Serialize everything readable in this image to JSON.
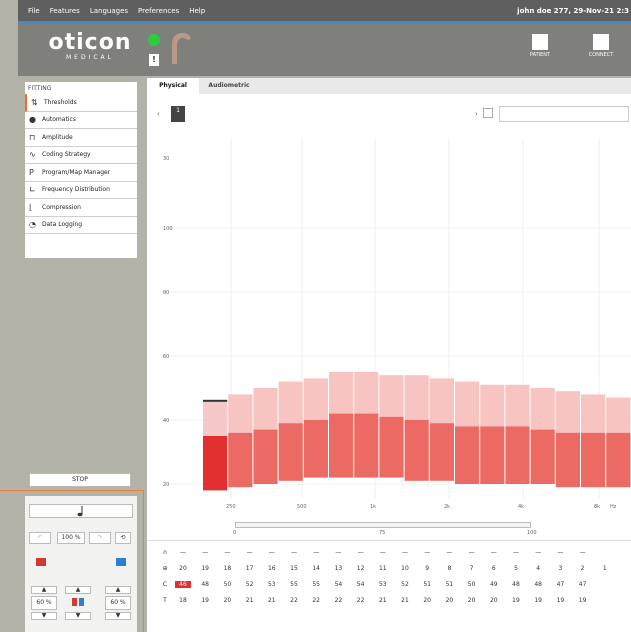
{
  "menu": {
    "items": [
      "File",
      "Features",
      "Languages",
      "Preferences",
      "Help"
    ],
    "user": "john doe 277, 29-Nov-21 2:3"
  },
  "logo": {
    "text": "oticon",
    "sub": "MEDICAL"
  },
  "header": {
    "battery": "!",
    "patient": "PATIENT",
    "connect": "CONNECT"
  },
  "sidebar": {
    "heading": "FITTING",
    "items": [
      {
        "label": "Thresholds",
        "icon": "thresholds-icon",
        "glyph": "⇅",
        "active": true
      },
      {
        "label": "Automatics",
        "icon": "automatics-icon",
        "glyph": "●",
        "active": false
      },
      {
        "label": "Amplitude",
        "icon": "amplitude-icon",
        "glyph": "⊓",
        "active": false
      },
      {
        "label": "Coding Strategy",
        "icon": "coding-strategy-icon",
        "glyph": "∿",
        "active": false
      },
      {
        "label": "Program/Map Manager",
        "icon": "program-map-icon",
        "glyph": "P",
        "active": false
      },
      {
        "label": "Frequency Distribution",
        "icon": "frequency-icon",
        "glyph": "∟",
        "active": false
      },
      {
        "label": "Compression",
        "icon": "compression-icon",
        "glyph": "⌊",
        "active": false
      },
      {
        "label": "Data Logging",
        "icon": "data-logging-icon",
        "glyph": "◔",
        "active": false
      }
    ]
  },
  "controls": {
    "stop": "STOP",
    "zoom": "100 %",
    "left_level": "60 %",
    "right_level": "60 %"
  },
  "tabs": [
    "Physical",
    "Audiometric"
  ],
  "toolbar": {
    "channel": "1"
  },
  "chart_data": {
    "type": "bar",
    "yticks": [
      "20",
      "40",
      "60",
      "80",
      "100",
      "30"
    ],
    "xticks": [
      "250",
      "500",
      "1k",
      "2k",
      "4k",
      "8k",
      "Hz"
    ],
    "bars": [
      {
        "t": 18,
        "c": 46,
        "top": 35
      },
      {
        "t": 19,
        "c": 48,
        "top": 36
      },
      {
        "t": 20,
        "c": 50,
        "top": 37
      },
      {
        "t": 21,
        "c": 52,
        "top": 39
      },
      {
        "t": 22,
        "c": 53,
        "top": 40
      },
      {
        "t": 22,
        "c": 55,
        "top": 42
      },
      {
        "t": 22,
        "c": 55,
        "top": 42
      },
      {
        "t": 22,
        "c": 54,
        "top": 41
      },
      {
        "t": 21,
        "c": 54,
        "top": 40
      },
      {
        "t": 21,
        "c": 53,
        "top": 39
      },
      {
        "t": 20,
        "c": 52,
        "top": 38
      },
      {
        "t": 20,
        "c": 51,
        "top": 38
      },
      {
        "t": 20,
        "c": 51,
        "top": 38
      },
      {
        "t": 20,
        "c": 50,
        "top": 37
      },
      {
        "t": 19,
        "c": 49,
        "top": 36
      },
      {
        "t": 19,
        "c": 48,
        "top": 36
      },
      {
        "t": 19,
        "c": 47,
        "top": 36
      }
    ]
  },
  "slider": {
    "left": "0",
    "mid": "75",
    "right": "100"
  },
  "table": {
    "rows": [
      {
        "label": "∩",
        "values": [
          "—",
          "—",
          "—",
          "—",
          "—",
          "—",
          "—",
          "—",
          "—",
          "—",
          "—",
          "—",
          "—",
          "—",
          "—",
          "—",
          "—",
          "—",
          "—"
        ]
      },
      {
        "label": "⊕",
        "values": [
          "20",
          "19",
          "18",
          "17",
          "16",
          "15",
          "14",
          "13",
          "12",
          "11",
          "10",
          "9",
          "8",
          "7",
          "6",
          "5",
          "4",
          "3",
          "2",
          "1"
        ]
      },
      {
        "label": "C",
        "values": [
          "46",
          "48",
          "50",
          "52",
          "53",
          "55",
          "55",
          "54",
          "54",
          "53",
          "52",
          "51",
          "51",
          "50",
          "49",
          "48",
          "48",
          "47",
          "47"
        ]
      },
      {
        "label": "T",
        "values": [
          "18",
          "19",
          "20",
          "21",
          "21",
          "22",
          "22",
          "22",
          "22",
          "21",
          "21",
          "20",
          "20",
          "20",
          "20",
          "19",
          "19",
          "19",
          "19"
        ]
      }
    ]
  }
}
